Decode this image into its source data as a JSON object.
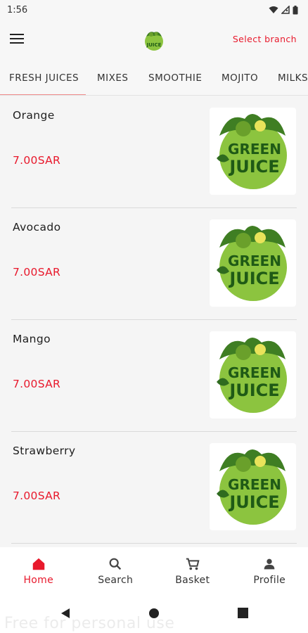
{
  "status_bar": {
    "time": "1:56"
  },
  "header": {
    "select_branch": "Select branch",
    "logo_text": "JUICE"
  },
  "tabs": [
    {
      "label": "FRESH JUICES",
      "active": true
    },
    {
      "label": "MIXES"
    },
    {
      "label": "SMOOTHIE"
    },
    {
      "label": "MOJITO"
    },
    {
      "label": "MILKS"
    }
  ],
  "products": [
    {
      "name": "Orange",
      "price": "7.00SAR",
      "logo_line1": "GREEN",
      "logo_line2": "JUICE"
    },
    {
      "name": "Avocado",
      "price": "7.00SAR",
      "logo_line1": "GREEN",
      "logo_line2": "JUICE"
    },
    {
      "name": "Mango",
      "price": "7.00SAR",
      "logo_line1": "GREEN",
      "logo_line2": "JUICE"
    },
    {
      "name": "Strawberry",
      "price": "7.00SAR",
      "logo_line1": "GREEN",
      "logo_line2": "JUICE"
    }
  ],
  "bottom_nav": [
    {
      "label": "Home",
      "icon": "home-icon",
      "active": true
    },
    {
      "label": "Search",
      "icon": "search-icon"
    },
    {
      "label": "Basket",
      "icon": "cart-icon"
    },
    {
      "label": "Profile",
      "icon": "profile-icon"
    }
  ],
  "watermark": "Free for personal use",
  "colors": {
    "accent": "#e8192c",
    "logo_green": "#8cc43f",
    "tab_indicator": "#f08c8c"
  }
}
